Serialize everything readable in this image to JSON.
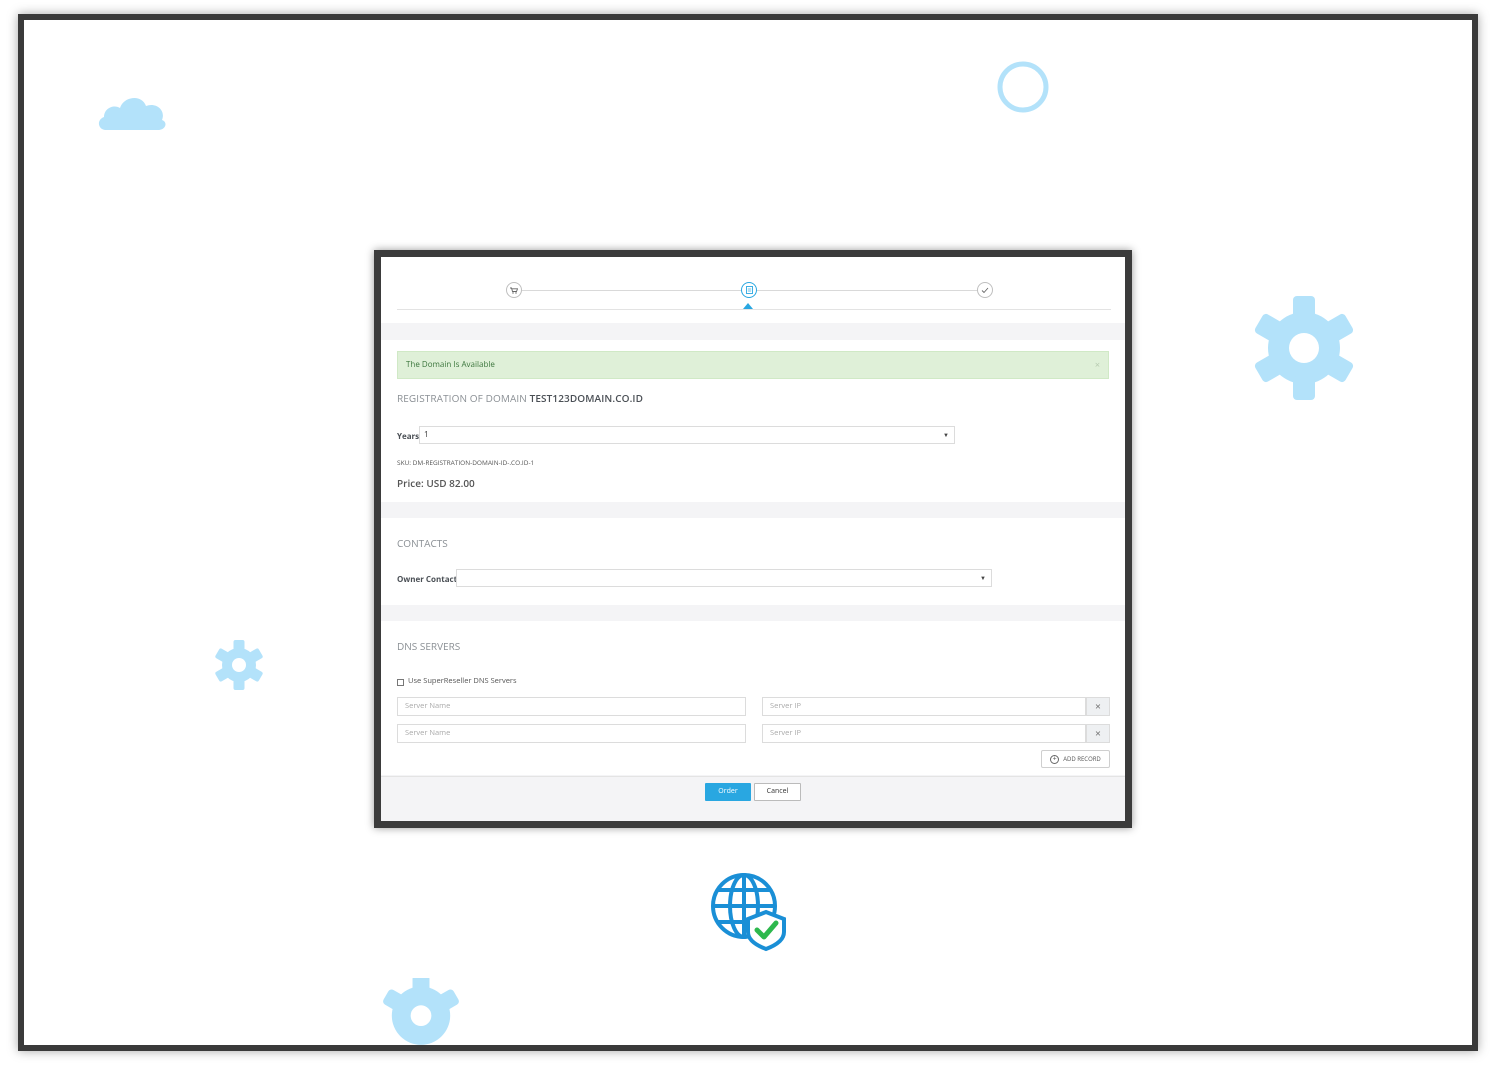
{
  "steps": {
    "icons": [
      "cart-icon",
      "document-icon",
      "check-icon"
    ],
    "active_index": 1
  },
  "alert": {
    "message": "The Domain Is Available",
    "close_symbol": "×"
  },
  "registration": {
    "prefix": "REGISTRATION OF DOMAIN",
    "domain": "TEST123DOMAIN.CO.ID",
    "years_label": "Years",
    "years_value": "1",
    "sku": "SKU: DM-REGISTRATION-DOMAIN-ID-.CO.ID-1",
    "price": "Price: USD 82.00"
  },
  "contacts": {
    "title": "CONTACTS",
    "owner_label": "Owner Contact",
    "owner_value": ""
  },
  "dns": {
    "title": "DNS SERVERS",
    "use_superreseller_label": "Use SuperReseller DNS Servers",
    "server_name_placeholder": "Server Name",
    "server_ip_placeholder": "Server IP",
    "remove_symbol": "×",
    "add_record_label": "ADD RECORD"
  },
  "footer": {
    "order_label": "Order",
    "cancel_label": "Cancel"
  },
  "colors": {
    "accent": "#29a7e1",
    "decor": "#b3e2fa",
    "alert_bg": "#dff0d8",
    "alert_text": "#3c763d"
  }
}
